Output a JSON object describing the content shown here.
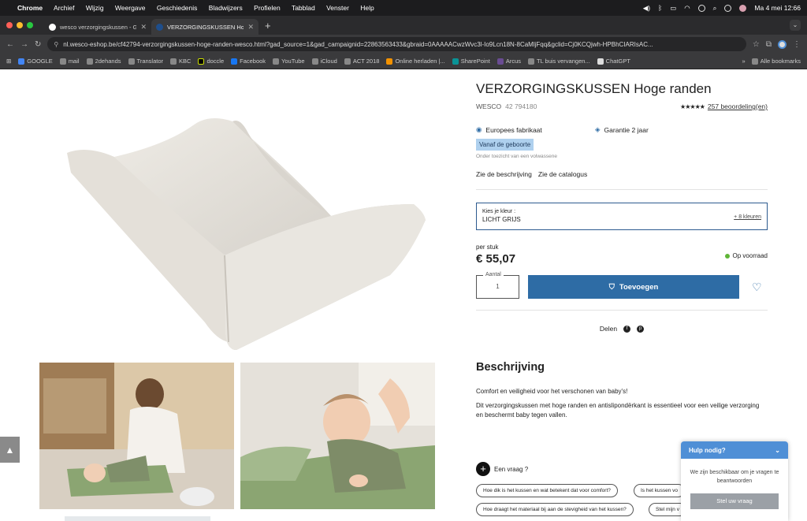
{
  "macos": {
    "menu": [
      "Chrome",
      "Archief",
      "Wijzig",
      "Weergave",
      "Geschiedenis",
      "Bladwijzers",
      "Profielen",
      "Tabblad",
      "Venster",
      "Help"
    ],
    "clock": "Ma 4 mei 12:66"
  },
  "tabs": [
    {
      "title": "wesco verzorgingskussen - G"
    },
    {
      "title": "VERZORGINGSKUSSEN Hoge"
    }
  ],
  "url": "nl.wesco-eshop.be/cf42794-verzorgingskussen-hoge-randen-wesco.html?gad_source=1&gad_campaignid=22863563433&gbraid=0AAAAACwzWvc3l-Io9Lcn18N-8CaMljFqq&gclid=Cj0KCQjwh-HPBhCIARIsAC...",
  "bookmarks": [
    "GOOGLE",
    "mail",
    "2dehands",
    "Translator",
    "KBC",
    "doccle",
    "Facebook",
    "YouTube",
    "iCloud",
    "ACT 2018",
    "Online herladen |...",
    "SharePoint",
    "Arcus",
    "TL buis vervangen...",
    "ChatGPT"
  ],
  "bookmarks_more": "»",
  "bookmarks_all": "Alle bookmarks",
  "product": {
    "title": "VERZORGINGSKUSSEN Hoge randen",
    "brand": "WESCO",
    "sku": "42 794180",
    "stars": "★★★★★",
    "reviews": "257 beoordeling(en)",
    "feature1": "Europees fabrikaat",
    "feature2": "Garantie 2 jaar",
    "age_badge": "Vanaf de geboorte",
    "supervision": "Onder toezicht van een volwassene",
    "link_description": "Zie de beschrijving",
    "link_catalog": "Zie de catalogus",
    "color_label": "Kies je kleur :",
    "color_value": "LICHT GRIJS",
    "color_more": "+ 8 kleuren",
    "per_unit": "per stuk",
    "price": "€ 55,07",
    "stock": "Op voorraad",
    "qty_label": "Aantal",
    "qty_value": "1",
    "add_button": "Toevoegen",
    "share_label": "Delen"
  },
  "description": {
    "title": "Beschrijving",
    "line1": "Comfort en veiligheid voor het verschonen van baby's!",
    "line2": "Dit verzorgingskussen met hoge randen en antislipondërkant is essentieel voor een veilige verzorging en beschermt baby tegen vallen."
  },
  "questions": {
    "ask": "Een vraag ?",
    "chips": [
      "Hoe dik is het kussen en wat betekent dat voor comfort?",
      "Is het kussen vo",
      "Hoe draagt het materiaal bij aan de stevigheid van het kussen?",
      "Stel mijn v"
    ]
  },
  "help": {
    "title": "Hulp nodig?",
    "message": "We zijn beschikbaar om je vragen te beantwoorden",
    "button": "Stel uw vraag"
  },
  "colors": {
    "primary_blue": "#2e6ca5",
    "help_blue": "#4f8fd6",
    "badge_blue": "#aed0ee",
    "stock_green": "#5fb537",
    "cushion": "#e8e4dd",
    "cushion_green": "#8ba572"
  },
  "icons": {
    "scroll_top": "▲",
    "heart": "♡",
    "lock": "🔒",
    "plus": "+"
  }
}
